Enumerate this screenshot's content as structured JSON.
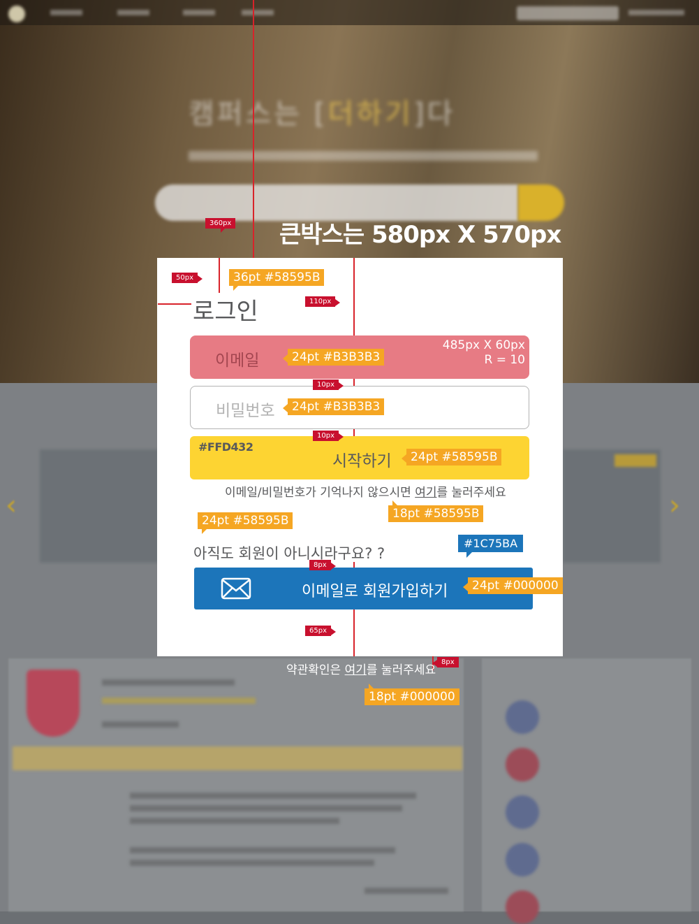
{
  "header": {
    "big_title": "큰박스는 580px X 570px"
  },
  "login": {
    "title": "로그인",
    "email_placeholder": "이메일",
    "email_spec": "485px X 60px",
    "email_radius": "R = 10",
    "password_placeholder": "비밀번호",
    "start_color_label": "#FFD432",
    "start_label": "시작하기",
    "forgot_prefix": "이메일/비밀번호가 기억나지 않으시면 ",
    "forgot_link": "여기",
    "forgot_suffix": "를 눌러주세요",
    "not_member": "아직도 회원이 아니시라구요? ?",
    "signup_label": "이메일로 회원가입하기",
    "terms_prefix": "약관확인은 ",
    "terms_link": "여기",
    "terms_suffix": "를 눌러주세요"
  },
  "annotations": {
    "px_360": "360px",
    "px_50": "50px",
    "title_spec": "36pt #58595B",
    "px_110": "110px",
    "email_spec": "24pt #B3B3B3",
    "gap_10a": "10px",
    "password_spec": "24pt #B3B3B3",
    "gap_10b": "10px",
    "start_spec": "24pt #58595B",
    "forgot_spec": "18pt #58595B",
    "not_member_spec": "24pt #58595B",
    "signup_color": "#1C75BA",
    "gap_8a": "8px",
    "signup_spec": "24pt #000000",
    "gap_65": "65px",
    "gap_8b": "8px",
    "terms_spec": "18pt #000000"
  },
  "background": {
    "hero_prefix": "캠퍼스는 [",
    "hero_highlight": "더하기",
    "hero_suffix": "]다"
  },
  "colors": {
    "title_text": "#58595B",
    "placeholder": "#B3B3B3",
    "start_button": "#FFD432",
    "signup_button": "#1C75BA",
    "annotation_orange": "#F5A623",
    "annotation_red": "#C8102E",
    "guide_line": "#D8232A"
  },
  "icons": {
    "signup": "envelope-icon"
  }
}
